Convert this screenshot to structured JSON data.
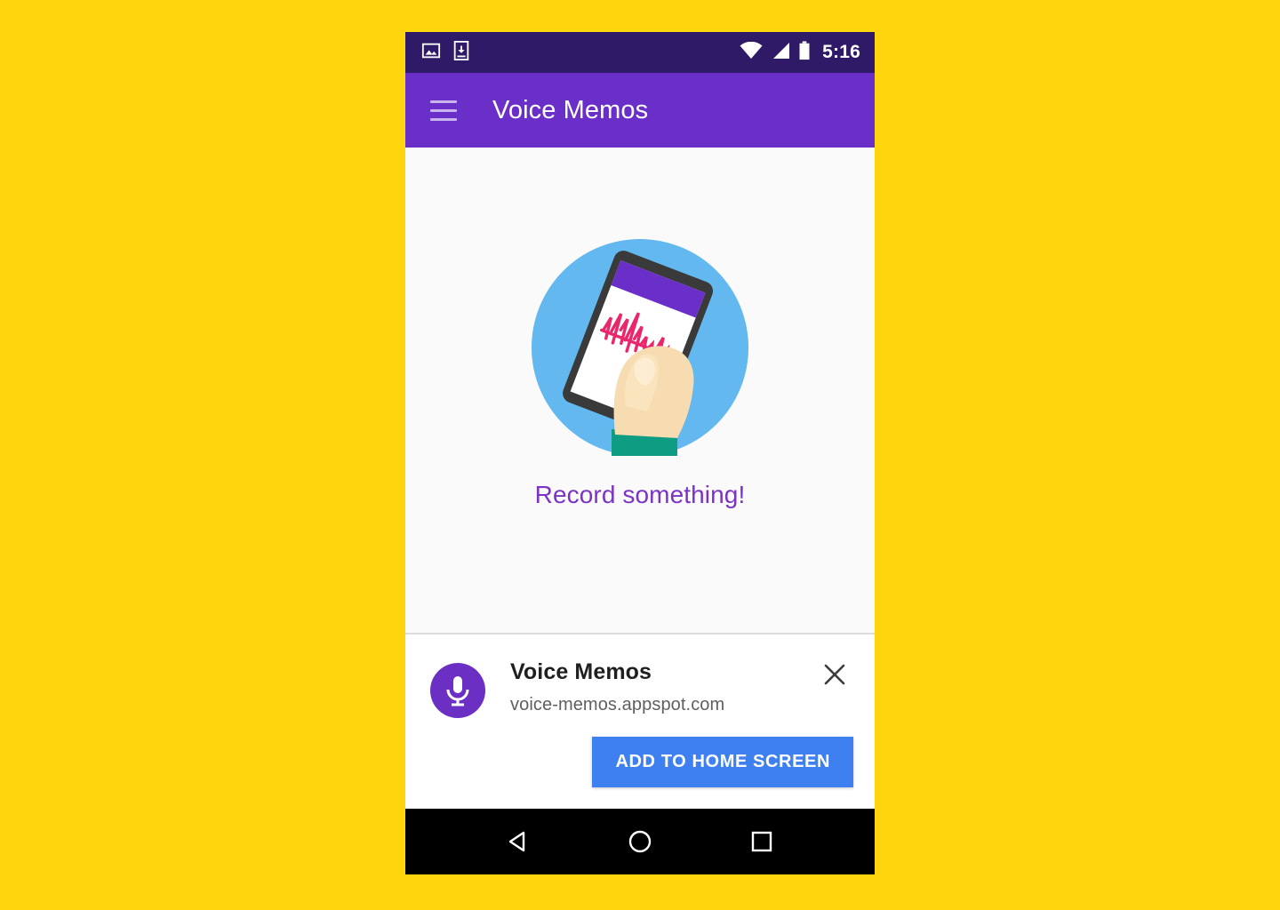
{
  "backdrop": {
    "color": "#FFD60D"
  },
  "status_bar": {
    "background": "#2E1A66",
    "time": "5:16",
    "left_icons": [
      "screenshot-icon",
      "download-icon"
    ],
    "right_icons": [
      "wifi-icon",
      "cell-signal-icon",
      "battery-icon"
    ]
  },
  "app_bar": {
    "background": "#6B2FC9",
    "title": "Voice Memos",
    "menu_icon": "hamburger-menu-icon"
  },
  "content": {
    "background": "#FAFAFA",
    "illustration": {
      "name": "hand-holding-phone-recording-illustration",
      "circle_color": "#63B8F0",
      "phone_bezel_color": "#3A3A3A",
      "phone_header_color": "#6B2FC9",
      "waveform_color": "#E8286B",
      "skin_color": "#F6DCB0",
      "sleeve_color": "#0E9C82"
    },
    "empty_state_text": "Record something!",
    "empty_state_text_color": "#7B33C4"
  },
  "install_banner": {
    "background": "#FFFFFF",
    "avatar_icon": "microphone-icon",
    "avatar_color": "#6B2FC4",
    "app_name": "Voice Memos",
    "app_origin": "voice-memos.appspot.com",
    "close_icon": "close-icon",
    "add_button_label": "ADD TO HOME SCREEN",
    "add_button_color": "#3F80F0"
  },
  "nav_bar": {
    "background": "#000000",
    "buttons": [
      {
        "name": "back-button",
        "icon": "triangle-left-icon"
      },
      {
        "name": "home-button",
        "icon": "circle-icon"
      },
      {
        "name": "recents-button",
        "icon": "square-icon"
      }
    ]
  }
}
